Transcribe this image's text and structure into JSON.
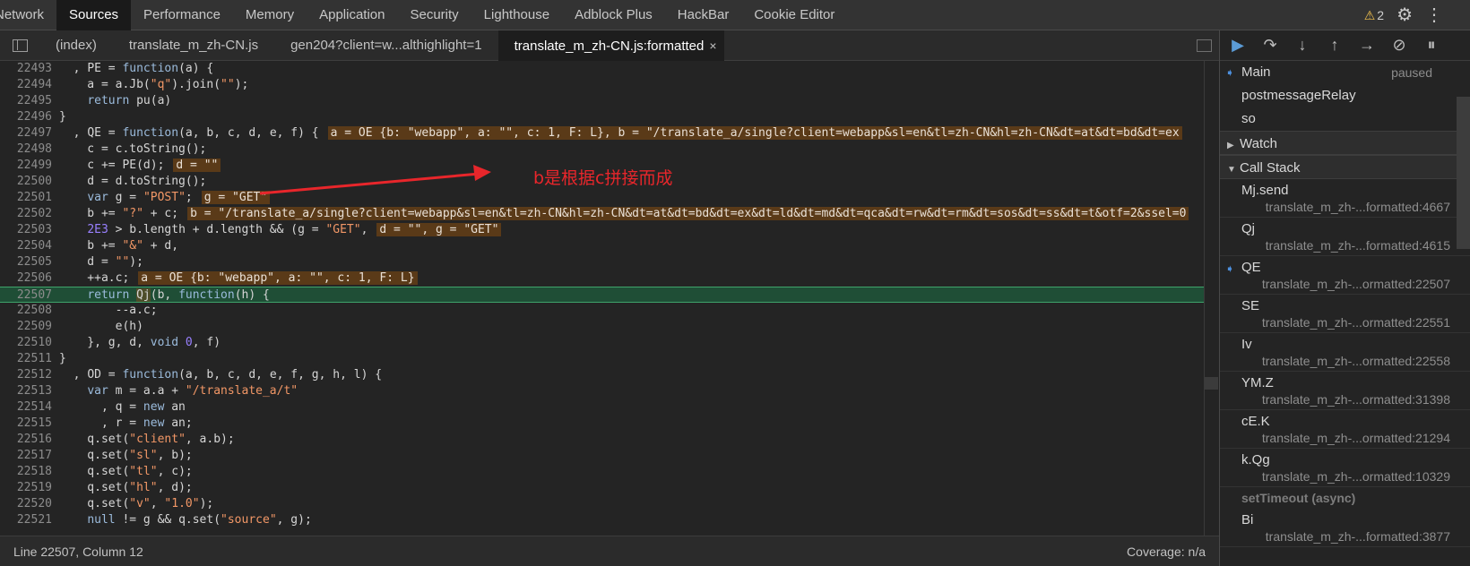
{
  "top_tabs": [
    "Network",
    "Sources",
    "Performance",
    "Memory",
    "Application",
    "Security",
    "Lighthouse",
    "Adblock Plus",
    "HackBar",
    "Cookie Editor"
  ],
  "top_tabs_active": "Sources",
  "warnings_count": "2",
  "file_tabs": [
    "(index)",
    "translate_m_zh-CN.js",
    "gen204?client=w...althighlight=1",
    "translate_m_zh-CN.js:formatted"
  ],
  "file_tab_close": "×",
  "annotation": "b是根据c拼接而成",
  "status": {
    "position": "Line 22507, Column 12",
    "coverage": "Coverage: n/a"
  },
  "threads": [
    {
      "name": "Main",
      "state": "paused",
      "selected": true
    },
    {
      "name": "postmessageRelay",
      "state": ""
    },
    {
      "name": "so",
      "state": ""
    }
  ],
  "sections": {
    "watch": "Watch",
    "call_stack": "Call Stack"
  },
  "call_stack": [
    {
      "fn": "Mj.send",
      "loc": "translate_m_zh-...formatted:4667",
      "current": false
    },
    {
      "fn": "Qj",
      "loc": "translate_m_zh-...formatted:4615",
      "current": false
    },
    {
      "fn": "QE",
      "loc": "translate_m_zh-...ormatted:22507",
      "current": true
    },
    {
      "fn": "SE",
      "loc": "translate_m_zh-...ormatted:22551",
      "current": false
    },
    {
      "fn": "Iv",
      "loc": "translate_m_zh-...ormatted:22558",
      "current": false
    },
    {
      "fn": "YM.Z",
      "loc": "translate_m_zh-...ormatted:31398",
      "current": false
    },
    {
      "fn": "cE.K",
      "loc": "translate_m_zh-...ormatted:21294",
      "current": false
    },
    {
      "fn": "k.Qg",
      "loc": "translate_m_zh-...ormatted:10329",
      "current": false
    }
  ],
  "async_separator": "setTimeout (async)",
  "async_frames": [
    {
      "fn": "Bi",
      "loc": "translate_m_zh-...formatted:3877"
    }
  ],
  "current_line": "22507",
  "code_lines": [
    {
      "n": "22493",
      "html": "  , <span class='v'>PE</span> = <span class='kw'>function</span>(a) {"
    },
    {
      "n": "22494",
      "html": "    a = a.Jb(<span class='str'>\"q\"</span>).join(<span class='str'>\"\"</span>);"
    },
    {
      "n": "22495",
      "html": "    <span class='kw'>return</span> pu(a)"
    },
    {
      "n": "22496",
      "html": "}"
    },
    {
      "n": "22497",
      "html": "  , <span class='v'>QE</span> = <span class='kw'>function</span>(a, b, c, d, e, f) {<span class='inline'>a = OE {b: \"webapp\", a: \"\", c: 1, F: L}, b = \"/translate_a/single?client=webapp&amp;sl=en&amp;tl=zh-CN&amp;hl=zh-CN&amp;dt=at&amp;dt=bd&amp;dt=ex</span>"
    },
    {
      "n": "22498",
      "html": "    c = c.toString();"
    },
    {
      "n": "22499",
      "html": "    c += PE(d);<span class='inline'>d = \"\"</span>"
    },
    {
      "n": "22500",
      "html": "    d = d.toString();"
    },
    {
      "n": "22501",
      "html": "    <span class='kw'>var</span> g = <span class='str'>\"POST\"</span>;<span class='inline'>g = \"GET\"</span>"
    },
    {
      "n": "22502",
      "html": "    b += <span class='str'>\"?\"</span> + c;<span class='inline'>b = \"/translate_a/single?client=webapp&amp;sl=en&amp;tl=zh-CN&amp;hl=zh-CN&amp;dt=at&amp;dt=bd&amp;dt=ex&amp;dt=ld&amp;dt=md&amp;dt=qca&amp;dt=rw&amp;dt=rm&amp;dt=sos&amp;dt=ss&amp;dt=t&amp;otf=2&amp;ssel=0</span>"
    },
    {
      "n": "22503",
      "html": "    <span class='num'>2E3</span> &gt; b.length + d.length &amp;&amp; (g = <span class='str'>\"GET\"</span>,<span class='inline'>d = \"\", g = \"GET\"</span>"
    },
    {
      "n": "22504",
      "html": "    b += <span class='str'>\"&amp;\"</span> + d,"
    },
    {
      "n": "22505",
      "html": "    d = <span class='str'>\"\"</span>);"
    },
    {
      "n": "22506",
      "html": "    ++a.c;<span class='inline'>a = OE {b: \"webapp\", a: \"\", c: 1, F: L}</span>"
    },
    {
      "n": "22507",
      "html": "    <span class='kw'>return</span> <span class='hl-qj'>Qj</span>(b, <span class='kw'>function</span>(h) {"
    },
    {
      "n": "22508",
      "html": "        --a.c;"
    },
    {
      "n": "22509",
      "html": "        e(h)"
    },
    {
      "n": "22510",
      "html": "    }, g, d, <span class='kw'>void</span> <span class='num'>0</span>, f)"
    },
    {
      "n": "22511",
      "html": "}"
    },
    {
      "n": "22512",
      "html": "  , <span class='v'>OD</span> = <span class='kw'>function</span>(a, b, c, d, e, f, g, h, l) {"
    },
    {
      "n": "22513",
      "html": "    <span class='kw'>var</span> m = a.a + <span class='str'>\"/translate_a/t\"</span>"
    },
    {
      "n": "22514",
      "html": "      , q = <span class='kw'>new</span> an"
    },
    {
      "n": "22515",
      "html": "      , r = <span class='kw'>new</span> an;"
    },
    {
      "n": "22516",
      "html": "    q.set(<span class='str'>\"client\"</span>, a.b);"
    },
    {
      "n": "22517",
      "html": "    q.set(<span class='str'>\"sl\"</span>, b);"
    },
    {
      "n": "22518",
      "html": "    q.set(<span class='str'>\"tl\"</span>, c);"
    },
    {
      "n": "22519",
      "html": "    q.set(<span class='str'>\"hl\"</span>, d);"
    },
    {
      "n": "22520",
      "html": "    q.set(<span class='str'>\"v\"</span>, <span class='str'>\"1.0\"</span>);"
    },
    {
      "n": "22521",
      "html": "    <span class='kw'>null</span> != g &amp;&amp; q.set(<span class='str'>\"source\"</span>, g);"
    }
  ]
}
